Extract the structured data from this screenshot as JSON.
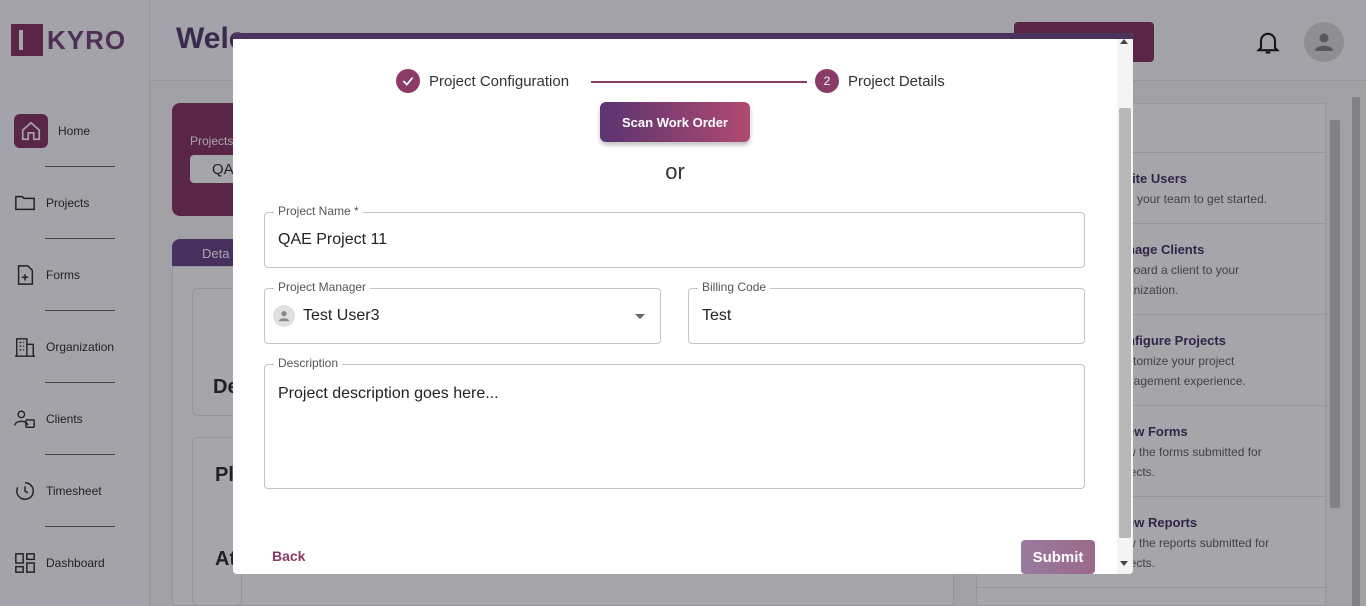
{
  "brand": {
    "logo_text": "KYRO"
  },
  "sidebar": {
    "items": [
      {
        "label": "Home",
        "icon": "home-icon"
      },
      {
        "label": "Projects",
        "icon": "folder-icon"
      },
      {
        "label": "Forms",
        "icon": "form-icon"
      },
      {
        "label": "Organization",
        "icon": "building-icon"
      },
      {
        "label": "Clients",
        "icon": "clients-icon"
      },
      {
        "label": "Timesheet",
        "icon": "clock-icon"
      },
      {
        "label": "Dashboard",
        "icon": "dashboard-icon"
      }
    ]
  },
  "header": {
    "welcome": "Welc"
  },
  "background": {
    "card_label": "Projects",
    "card_value": "QA",
    "tab_label": "Deta",
    "headings": [
      "De",
      "Pl",
      "At"
    ]
  },
  "right_panel": {
    "title": "s",
    "items": [
      {
        "title": "rite Users",
        "desc": "d your team to get started."
      },
      {
        "title": "nage Clients",
        "desc": "board a client to your anization."
      },
      {
        "title": "nfigure Projects",
        "desc": "stomize your project nagement experience."
      },
      {
        "title": "ew Forms",
        "desc": "w the forms submitted for jects."
      },
      {
        "title": "ew Reports",
        "desc": "w the reports submitted for jects."
      }
    ]
  },
  "modal": {
    "steps": [
      {
        "label": "Project Configuration",
        "state": "completed",
        "icon": "check-icon"
      },
      {
        "label": "Project Details",
        "state": "active",
        "number": "2"
      }
    ],
    "scan_button": "Scan Work Order",
    "or_text": "or",
    "fields": {
      "project_name": {
        "label": "Project Name *",
        "value": "QAE Project 11"
      },
      "project_manager": {
        "label": "Project Manager",
        "value": "Test User3"
      },
      "billing_code": {
        "label": "Billing Code",
        "value": "Test"
      },
      "description": {
        "label": "Description",
        "value": "Project description goes here..."
      }
    },
    "back_label": "Back",
    "submit_label": "Submit"
  },
  "colors": {
    "accent": "#8a3b67",
    "accent_dark": "#4b3360"
  }
}
